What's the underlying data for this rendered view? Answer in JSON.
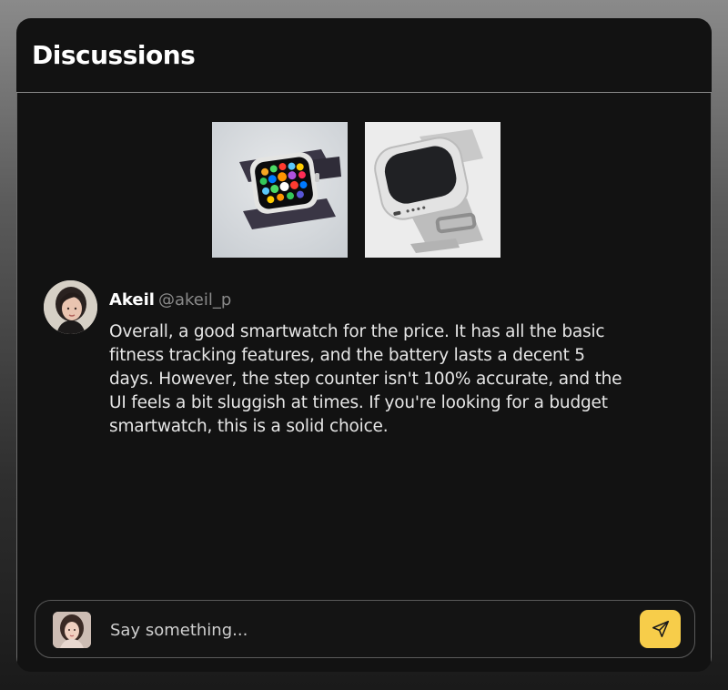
{
  "header": {
    "title": "Discussions"
  },
  "attachments": [
    {
      "icon": "smartwatch-image"
    },
    {
      "icon": "smartwatch-image"
    }
  ],
  "post": {
    "author_name": "Akeil",
    "author_handle": "@akeil_p",
    "text": "Overall, a good smartwatch for the price. It has all the basic fitness tracking features, and the battery lasts a decent 5 days. However, the step counter isn't 100% accurate, and the UI feels a bit sluggish at times. If you're looking for a budget smartwatch, this is a solid choice."
  },
  "composer": {
    "placeholder": "Say something...",
    "value": "",
    "send_icon": "send-icon"
  },
  "colors": {
    "background": "#121212",
    "accent": "#f7cd4a",
    "text": "#e6e6e6",
    "muted": "#8a8a8a"
  }
}
